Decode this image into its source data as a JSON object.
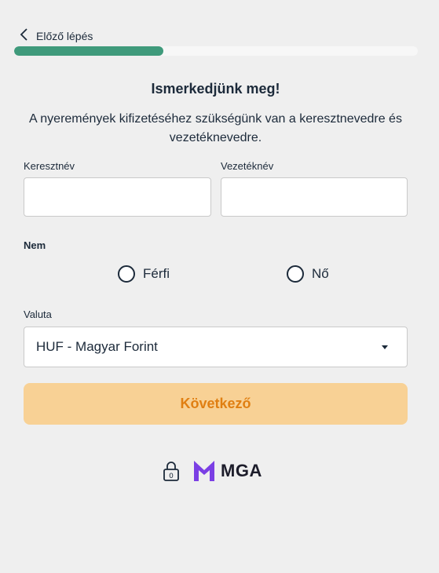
{
  "nav": {
    "back_label": "Előző lépés"
  },
  "progress": {
    "value": 0.37
  },
  "heading": {
    "title": "Ismerkedjünk meg!",
    "subtitle": "A nyeremények kifizetéséhez szükségünk van a keresztnevedre és vezetéknevedre."
  },
  "form": {
    "first_name": {
      "label": "Keresztnév",
      "value": ""
    },
    "last_name": {
      "label": "Vezetéknév",
      "value": ""
    },
    "gender": {
      "label": "Nem",
      "options": [
        "Férfi",
        "Nő"
      ]
    },
    "currency": {
      "label": "Valuta",
      "selected": "HUF - Magyar Forint"
    },
    "next_label": "Következő"
  },
  "footer": {
    "lock_digit": "0",
    "license_logo_text": "MGA"
  },
  "colors": {
    "progress_fill": "#3f9a7b",
    "button_bg": "#f8d195",
    "button_text": "#e07f12",
    "mga_purple": "#7b3fe4"
  },
  "icons": {
    "back": "chevron-left-icon",
    "dropdown": "caret-down-icon",
    "lock": "lock-icon",
    "mga": "mga-logo-icon"
  }
}
